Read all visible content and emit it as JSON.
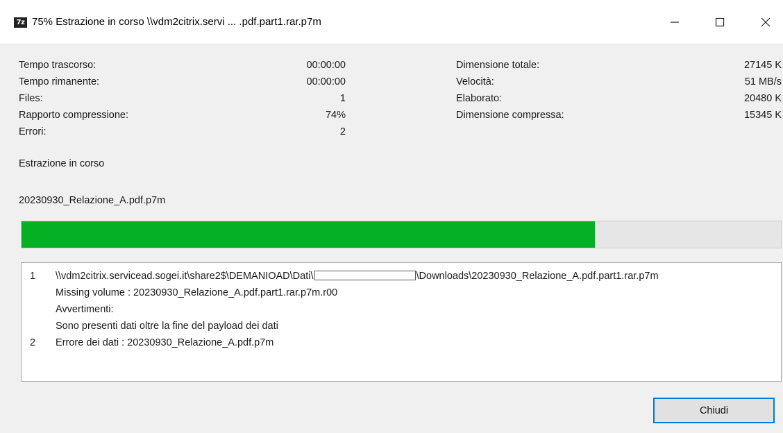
{
  "window": {
    "app_icon": "7z",
    "title": "75% Estrazione in corso \\\\vdm2citrix.servi ... .pdf.part1.rar.p7m",
    "controls": {
      "minimize_icon": "minimize-icon",
      "maximize_icon": "maximize-icon",
      "close_icon": "close-icon"
    }
  },
  "stats_left": [
    {
      "label": "Tempo trascorso:",
      "value": "00:00:00"
    },
    {
      "label": "Tempo rimanente:",
      "value": "00:00:00"
    },
    {
      "label": "Files:",
      "value": "1"
    },
    {
      "label": "Rapporto compressione:",
      "value": "74%"
    },
    {
      "label": "Errori:",
      "value": "2"
    }
  ],
  "stats_right": [
    {
      "label": "Dimensione totale:",
      "value": "27145 K"
    },
    {
      "label": "Velocità:",
      "value": "51 MB/s"
    },
    {
      "label": "Elaborato:",
      "value": "20480 K"
    },
    {
      "label": "Dimensione compressa:",
      "value": "15345 K"
    }
  ],
  "status_text": "Estrazione in corso",
  "current_file": "20230930_Relazione_A.pdf.p7m",
  "progress": {
    "fraction": 0.755,
    "color": "#06b025"
  },
  "log": {
    "entries": [
      {
        "num": "1",
        "path_prefix": "\\\\vdm2citrix.servicead.sogei.it\\share2$\\DEMANIOAD\\Dati\\",
        "path_suffix": "\\Downloads\\20230930_Relazione_A.pdf.part1.rar.p7m"
      },
      {
        "num": "",
        "text": "Missing volume : 20230930_Relazione_A.pdf.part1.rar.p7m.r00"
      },
      {
        "num": "",
        "text": "Avvertimenti:"
      },
      {
        "num": "",
        "text": "Sono presenti dati oltre la fine del payload dei dati"
      },
      {
        "num": "2",
        "text": "Errore dei dati : 20230930_Relazione_A.pdf.p7m"
      }
    ]
  },
  "buttons": {
    "close_label": "Chiudi"
  }
}
